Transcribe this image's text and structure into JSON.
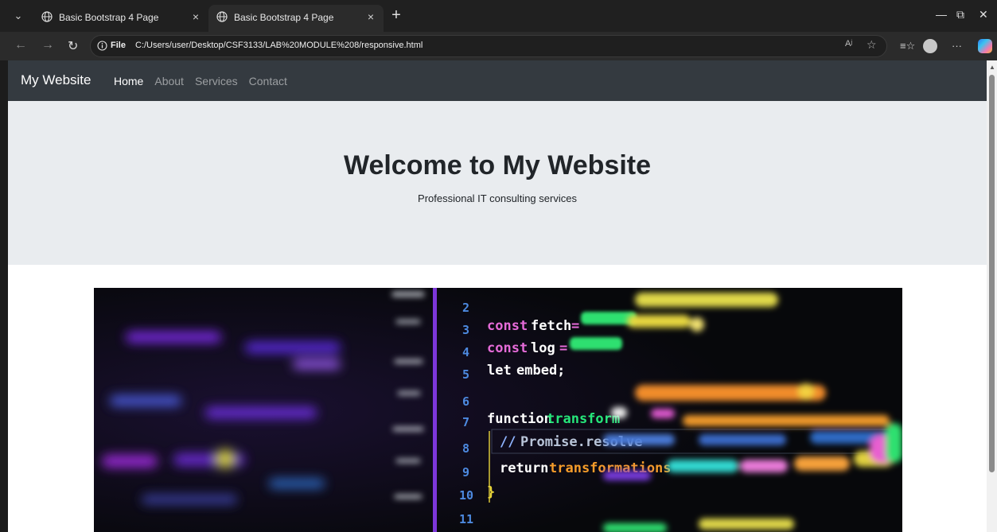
{
  "browser": {
    "tabs": [
      {
        "title": "Basic Bootstrap 4 Page",
        "close": "×"
      },
      {
        "title": "Basic Bootstrap 4 Page",
        "close": "×"
      }
    ],
    "new_tab": "+",
    "address": {
      "scheme": "File",
      "url": "C:/Users/user/Desktop/CSF3133/LAB%20MODULE%208/responsive.html",
      "read_aloud": "Aʲ"
    },
    "window_controls": {
      "minimize": "—",
      "restore": "⧉",
      "close": "✕"
    },
    "more": "···"
  },
  "site": {
    "brand": "My Website",
    "nav": [
      {
        "label": "Home",
        "active": true
      },
      {
        "label": "About",
        "active": false
      },
      {
        "label": "Services",
        "active": false
      },
      {
        "label": "Contact",
        "active": false
      }
    ],
    "jumbotron": {
      "title": "Welcome to My Website",
      "subtitle": "Professional IT consulting services"
    },
    "hero_code": {
      "line_numbers": [
        "2",
        "3",
        "4",
        "5",
        "6",
        "7",
        "8",
        "9",
        "10",
        "11"
      ],
      "lines": [
        {
          "kw": "const",
          "id": "fetch",
          "op": "="
        },
        {
          "kw": "const",
          "id": "log",
          "op": "="
        },
        {
          "kw": "let",
          "id": "embed;",
          "op": ""
        },
        {
          "kw": "",
          "id": "",
          "op": ""
        },
        {
          "kw": "function",
          "id": "transform",
          "op": ""
        },
        {
          "kw": "//",
          "id": "Promise.resolve",
          "op": ""
        },
        {
          "kw": "return",
          "id": "transformations",
          "op": ""
        },
        {
          "kw": "}",
          "id": "",
          "op": ""
        }
      ]
    }
  },
  "colors": {
    "navbar": "#343a40",
    "jumbotron": "#e9ecef",
    "code_bg": "#07080b",
    "keyword": "#ffffff",
    "function_name": "#26e67a",
    "accent_purple": "#8a3cf0",
    "accent_yellow": "#e8d43a"
  }
}
